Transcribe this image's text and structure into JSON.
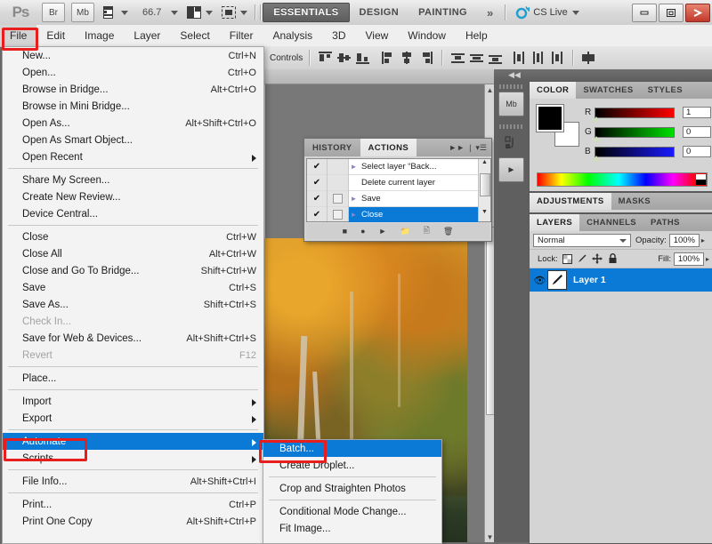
{
  "app": {
    "logo": "Ps",
    "bridge_button": "Br",
    "mini_bridge_button": "Mb",
    "zoom_level": "66.7",
    "view_extras_icon": "screen-mode-icon",
    "arrange_icon": "arrange-documents-icon",
    "workspaces": [
      {
        "label": "ESSENTIALS",
        "active": true
      },
      {
        "label": "DESIGN",
        "active": false
      },
      {
        "label": "PAINTING",
        "active": false
      }
    ],
    "more_workspaces": "»",
    "cs_live": "CS Live",
    "window_buttons": {
      "minimize": "—",
      "restore": "▣",
      "close": "✖"
    }
  },
  "menubar": {
    "items": [
      {
        "label": "File",
        "open": true
      },
      {
        "label": "Edit",
        "open": false
      },
      {
        "label": "Image",
        "open": false
      },
      {
        "label": "Layer",
        "open": false
      },
      {
        "label": "Select",
        "open": false
      },
      {
        "label": "Filter",
        "open": false
      },
      {
        "label": "Analysis",
        "open": false
      },
      {
        "label": "3D",
        "open": false
      },
      {
        "label": "View",
        "open": false
      },
      {
        "label": "Window",
        "open": false
      },
      {
        "label": "Help",
        "open": false
      }
    ]
  },
  "options_bar": {
    "label": "Controls",
    "align_groups": [
      [
        "align-top-edges-icon",
        "align-vertical-centers-icon",
        "align-bottom-edges-icon"
      ],
      [
        "align-left-edges-icon",
        "align-horizontal-centers-icon",
        "align-right-edges-icon"
      ],
      [
        "distribute-top-edges-icon",
        "distribute-vertical-centers-icon",
        "distribute-bottom-edges-icon"
      ],
      [
        "distribute-left-edges-icon",
        "distribute-horizontal-centers-icon",
        "distribute-right-edges-icon"
      ],
      [
        "auto-align-layers-icon"
      ]
    ]
  },
  "file_menu": {
    "groups": [
      [
        {
          "label": "New...",
          "shortcut": "Ctrl+N",
          "disabled": false,
          "submenu": false,
          "highlighted": false
        },
        {
          "label": "Open...",
          "shortcut": "Ctrl+O",
          "disabled": false,
          "submenu": false,
          "highlighted": false
        },
        {
          "label": "Browse in Bridge...",
          "shortcut": "Alt+Ctrl+O",
          "disabled": false,
          "submenu": false,
          "highlighted": false
        },
        {
          "label": "Browse in Mini Bridge...",
          "shortcut": "",
          "disabled": false,
          "submenu": false,
          "highlighted": false
        },
        {
          "label": "Open As...",
          "shortcut": "Alt+Shift+Ctrl+O",
          "disabled": false,
          "submenu": false,
          "highlighted": false
        },
        {
          "label": "Open As Smart Object...",
          "shortcut": "",
          "disabled": false,
          "submenu": false,
          "highlighted": false
        },
        {
          "label": "Open Recent",
          "shortcut": "",
          "disabled": false,
          "submenu": true,
          "highlighted": false
        }
      ],
      [
        {
          "label": "Share My Screen...",
          "shortcut": "",
          "disabled": false,
          "submenu": false,
          "highlighted": false
        },
        {
          "label": "Create New Review...",
          "shortcut": "",
          "disabled": false,
          "submenu": false,
          "highlighted": false
        },
        {
          "label": "Device Central...",
          "shortcut": "",
          "disabled": false,
          "submenu": false,
          "highlighted": false
        }
      ],
      [
        {
          "label": "Close",
          "shortcut": "Ctrl+W",
          "disabled": false,
          "submenu": false,
          "highlighted": false
        },
        {
          "label": "Close All",
          "shortcut": "Alt+Ctrl+W",
          "disabled": false,
          "submenu": false,
          "highlighted": false
        },
        {
          "label": "Close and Go To Bridge...",
          "shortcut": "Shift+Ctrl+W",
          "disabled": false,
          "submenu": false,
          "highlighted": false
        },
        {
          "label": "Save",
          "shortcut": "Ctrl+S",
          "disabled": false,
          "submenu": false,
          "highlighted": false
        },
        {
          "label": "Save As...",
          "shortcut": "Shift+Ctrl+S",
          "disabled": false,
          "submenu": false,
          "highlighted": false
        },
        {
          "label": "Check In...",
          "shortcut": "",
          "disabled": true,
          "submenu": false,
          "highlighted": false
        },
        {
          "label": "Save for Web & Devices...",
          "shortcut": "Alt+Shift+Ctrl+S",
          "disabled": false,
          "submenu": false,
          "highlighted": false
        },
        {
          "label": "Revert",
          "shortcut": "F12",
          "disabled": true,
          "submenu": false,
          "highlighted": false
        }
      ],
      [
        {
          "label": "Place...",
          "shortcut": "",
          "disabled": false,
          "submenu": false,
          "highlighted": false
        }
      ],
      [
        {
          "label": "Import",
          "shortcut": "",
          "disabled": false,
          "submenu": true,
          "highlighted": false
        },
        {
          "label": "Export",
          "shortcut": "",
          "disabled": false,
          "submenu": true,
          "highlighted": false
        }
      ],
      [
        {
          "label": "Automate",
          "shortcut": "",
          "disabled": false,
          "submenu": true,
          "highlighted": true
        },
        {
          "label": "Scripts",
          "shortcut": "",
          "disabled": false,
          "submenu": true,
          "highlighted": false
        }
      ],
      [
        {
          "label": "File Info...",
          "shortcut": "Alt+Shift+Ctrl+I",
          "disabled": false,
          "submenu": false,
          "highlighted": false
        }
      ],
      [
        {
          "label": "Print...",
          "shortcut": "Ctrl+P",
          "disabled": false,
          "submenu": false,
          "highlighted": false
        },
        {
          "label": "Print One Copy",
          "shortcut": "Alt+Shift+Ctrl+P",
          "disabled": false,
          "submenu": false,
          "highlighted": false
        }
      ]
    ]
  },
  "automate_menu": {
    "groups": [
      [
        {
          "label": "Batch...",
          "shortcut": "",
          "disabled": false,
          "submenu": false,
          "highlighted": true
        },
        {
          "label": "Create Droplet...",
          "shortcut": "",
          "disabled": false,
          "submenu": false,
          "highlighted": false
        }
      ],
      [
        {
          "label": "Crop and Straighten Photos",
          "shortcut": "",
          "disabled": false,
          "submenu": false,
          "highlighted": false
        }
      ],
      [
        {
          "label": "Conditional Mode Change...",
          "shortcut": "",
          "disabled": false,
          "submenu": false,
          "highlighted": false
        },
        {
          "label": "Fit Image...",
          "shortcut": "",
          "disabled": false,
          "submenu": false,
          "highlighted": false
        }
      ]
    ]
  },
  "actions_panel": {
    "tabs": [
      {
        "label": "HISTORY",
        "active": false
      },
      {
        "label": "ACTIONS",
        "active": true
      }
    ],
    "collapse_icon": "collapse-to-icons-icon",
    "menu_icon": "panel-menu-icon",
    "rows": [
      {
        "checked": true,
        "toggle_box": false,
        "expandable": true,
        "label": "Select layer “Back...",
        "selected": false
      },
      {
        "checked": true,
        "toggle_box": false,
        "expandable": false,
        "label": "Delete current layer",
        "selected": false
      },
      {
        "checked": true,
        "toggle_box": true,
        "expandable": true,
        "label": "Save",
        "selected": false
      },
      {
        "checked": true,
        "toggle_box": true,
        "expandable": true,
        "label": "Close",
        "selected": true
      }
    ],
    "footer_icons": [
      "stop-icon",
      "record-icon",
      "play-icon",
      "new-set-icon",
      "new-action-icon",
      "delete-icon"
    ]
  },
  "dock": {
    "collapse_icon": "collapse-panels-icon",
    "rail_buttons": [
      "mini-bridge-icon",
      "history-icon",
      "actions-icon"
    ],
    "color_panel": {
      "tabs": [
        {
          "label": "COLOR",
          "active": true
        },
        {
          "label": "SWATCHES",
          "active": false
        },
        {
          "label": "STYLES",
          "active": false
        }
      ],
      "foreground_color": "#000000",
      "background_color": "#ffffff",
      "channels": [
        {
          "label": "R",
          "value": "1"
        },
        {
          "label": "G",
          "value": "0"
        },
        {
          "label": "B",
          "value": "0"
        }
      ]
    },
    "adjustments_panel": {
      "tabs": [
        {
          "label": "ADJUSTMENTS",
          "active": true
        },
        {
          "label": "MASKS",
          "active": false
        }
      ]
    },
    "layers_panel": {
      "tabs": [
        {
          "label": "LAYERS",
          "active": true
        },
        {
          "label": "CHANNELS",
          "active": false
        },
        {
          "label": "PATHS",
          "active": false
        }
      ],
      "blend_mode": "Normal",
      "opacity_label": "Opacity:",
      "opacity_value": "100%",
      "lock_label": "Lock:",
      "lock_icons": [
        "lock-transparency-icon",
        "lock-image-icon",
        "lock-position-icon",
        "lock-all-icon"
      ],
      "fill_label": "Fill:",
      "fill_value": "100%",
      "layers": [
        {
          "name": "Layer 1",
          "visible": true,
          "selected": true
        }
      ]
    }
  },
  "document": {
    "image_description": "autumn-forest-photo"
  },
  "highlights": {
    "color": "#e81d1d",
    "targets": [
      "File",
      "Automate",
      "Batch..."
    ]
  }
}
